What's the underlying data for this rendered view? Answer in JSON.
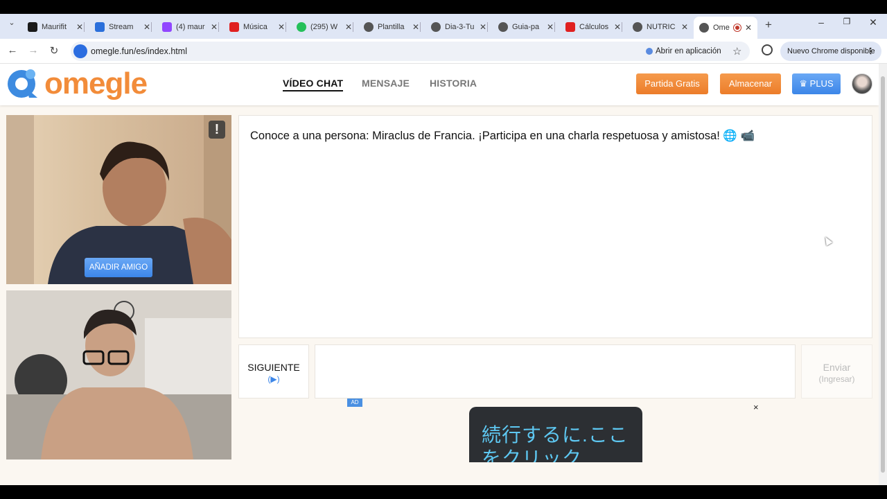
{
  "browser": {
    "tabs": [
      {
        "title": "Maurifit",
        "color": "#1a1a1a"
      },
      {
        "title": "Stream",
        "color": "#2a6fdb"
      },
      {
        "title": "(4) maur",
        "color": "#9146ff"
      },
      {
        "title": "Música",
        "color": "#e02020"
      },
      {
        "title": "(295) W",
        "color": "#25c05a"
      },
      {
        "title": "Plantilla",
        "color": "#555555"
      },
      {
        "title": "Dia-3-Tu",
        "color": "#555555"
      },
      {
        "title": "Guia-pa",
        "color": "#555555"
      },
      {
        "title": "Cálculos",
        "color": "#e02020"
      },
      {
        "title": "NUTRIC",
        "color": "#555555"
      },
      {
        "title": "Ome",
        "color": "#555555"
      }
    ],
    "url": "omegle.fun/es/index.html",
    "open_in_app": "Abrir en aplicación",
    "chrome_update": "Nuevo Chrome disponible"
  },
  "site": {
    "logo_text": "omegle",
    "nav": {
      "video_chat": "VÍDEO CHAT",
      "message": "MENSAJE",
      "history": "HISTORIA"
    },
    "buttons": {
      "free_match": "Partida Gratis",
      "store": "Almacenar",
      "plus": "PLUS"
    },
    "colors": {
      "orange": "#ec7d2a",
      "blue": "#3c86e8",
      "logo_blue": "#3d8be0"
    }
  },
  "video": {
    "report_label": "!",
    "add_friend": "AÑADIR AMIGO"
  },
  "chat": {
    "message": "Conoce a una persona: Miraclus de Francia. ¡Participa en una charla respetuosa y amistosa! 🌐 📹",
    "next_label": "SIGUIENTE",
    "next_sub": "(▶)",
    "send_label": "Enviar",
    "send_sub": "(Ingresar)",
    "input_value": ""
  },
  "ad": {
    "tag": "AD",
    "close": "×",
    "text": "続行するに.ここ\nをクリック"
  }
}
